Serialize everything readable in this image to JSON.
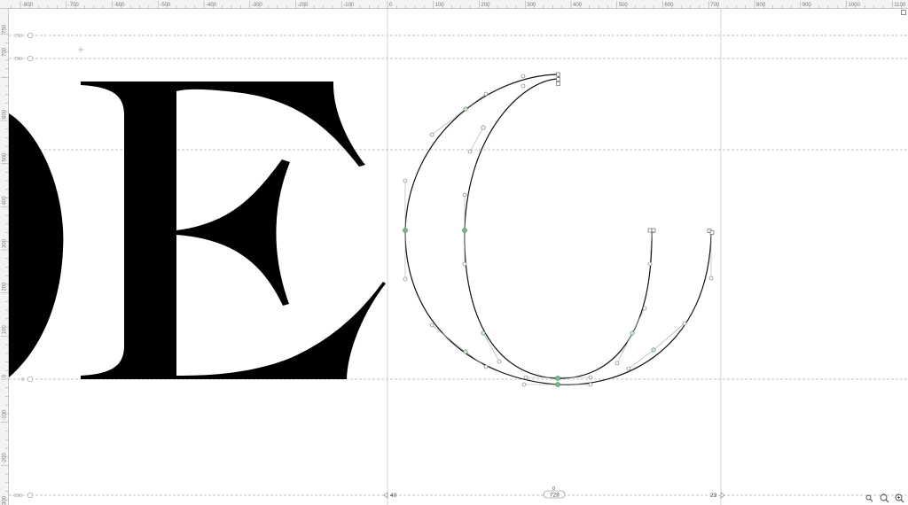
{
  "ruler": {
    "top_labels": [
      "-800",
      "-700",
      "-600",
      "-500",
      "-400",
      "-300",
      "-200",
      "-100",
      "0",
      "100",
      "200",
      "300",
      "400",
      "500",
      "600",
      "700",
      "800",
      "900",
      "1000",
      "1100"
    ],
    "left_labels": [
      "750",
      "700",
      "600",
      "500",
      "400",
      "300",
      "200",
      "100",
      "0",
      "-100",
      "-200",
      "-300"
    ]
  },
  "guides": {
    "labels": [
      "750",
      "700",
      "0",
      "-200"
    ]
  },
  "metrics": {
    "lsb": "40",
    "width": "728",
    "rsb": "23",
    "top_value": "0"
  },
  "icons": {
    "zoom_out": "zoom-out-icon",
    "zoom_fit": "zoom-fit-icon",
    "zoom_in": "zoom-in-icon"
  }
}
